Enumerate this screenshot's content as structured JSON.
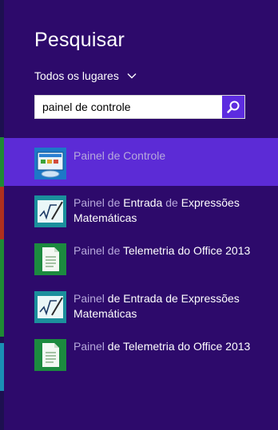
{
  "search_pane": {
    "title": "Pesquisar",
    "scope_label": "Todos os lugares",
    "query": "painel de controle"
  },
  "results": [
    {
      "icon": "control-panel-icon",
      "segments": [
        {
          "text": "Painel de Controle",
          "match": true
        }
      ],
      "selected": true
    },
    {
      "icon": "math-input-panel-icon",
      "segments": [
        {
          "text": "Painel de ",
          "match": true
        },
        {
          "text": "Entrada ",
          "match": false
        },
        {
          "text": "de ",
          "match": true
        },
        {
          "text": "Expressões Matemáticas",
          "match": false
        }
      ],
      "selected": false
    },
    {
      "icon": "office-telemetry-icon",
      "segments": [
        {
          "text": "Painel de ",
          "match": true
        },
        {
          "text": "Telemetria do Office 2013",
          "match": false
        }
      ],
      "selected": false
    },
    {
      "icon": "math-input-panel-icon",
      "segments": [
        {
          "text": "Painel",
          "match": true
        },
        {
          "text": " de Entrada de Expressões Matemáticas",
          "match": false
        }
      ],
      "selected": false
    },
    {
      "icon": "office-telemetry-icon",
      "segments": [
        {
          "text": "Painel",
          "match": true
        },
        {
          "text": " de Telemetria do Office 2013",
          "match": false
        }
      ],
      "selected": false
    }
  ],
  "colors": {
    "pane_bg": "#2d0a6b",
    "selected_bg": "#5c2bd6",
    "accent": "#5d2ce0",
    "match_text": "#b7a9dc"
  }
}
